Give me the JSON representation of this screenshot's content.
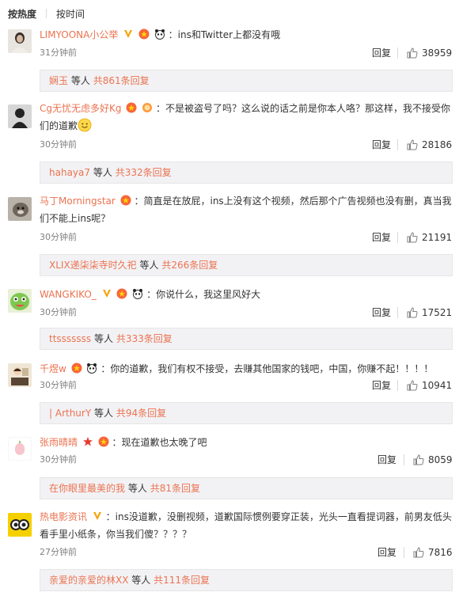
{
  "tabs": {
    "hot": "按热度",
    "time": "按时间"
  },
  "reply_label": "回复",
  "others_label": "等人",
  "comments": [
    {
      "user": "LIMYOONA小公举",
      "text": "：ins和Twitter上都没有哦",
      "time": "31分钟前",
      "likes": "38959",
      "reply_user": "娴玉",
      "reply_count": "共861条回复"
    },
    {
      "user": "Cg无忧无虑多好Kg",
      "text": "：不是被盗号了吗？这么说的话之前是你本人咯？那这样，我不接受你",
      "text2": "们的道歉",
      "time": "30分钟前",
      "likes": "28186",
      "reply_user": "hahaya7",
      "reply_count": "共332条回复"
    },
    {
      "user": "马丁Morningstar",
      "text": "：简直是在放屁，ins上没有这个视频，然后那个广告视频也没有删，真当我",
      "text2": "们不能上ins呢？",
      "time": "30分钟前",
      "likes": "21191",
      "reply_user": "XLIX递柒柒寺时久祀",
      "reply_count": "共266条回复"
    },
    {
      "user": "WANGKIKO_",
      "text": "：你说什么，我这里风好大",
      "time": "30分钟前",
      "likes": "17521",
      "reply_user": "ttsssssss",
      "reply_count": "共333条回复"
    },
    {
      "user": "千煜w",
      "text": "：你的道歉，我们有权不接受，去赚其他国家的钱吧，中国，你赚不起！！！！",
      "time": "30分钟前",
      "likes": "10941",
      "reply_user": "| ArthurY",
      "reply_count": "共94条回复"
    },
    {
      "user": "张雨晴晴",
      "text": "：现在道歉也太晚了吧",
      "time": "30分钟前",
      "likes": "8059",
      "reply_user": "在你眼里最美的我",
      "reply_count": "共81条回复"
    },
    {
      "user": "热电影资讯",
      "text": "：ins没道歉，没删视频，道歉国际惯例要穿正装，光头一直看提词器，前男友低头",
      "text2": "看手里小纸条，你当我们傻？？？？",
      "time": "27分钟前",
      "likes": "7816",
      "reply_user": "亲爱的亲爱的林XX",
      "reply_count": "共111条回复"
    }
  ]
}
